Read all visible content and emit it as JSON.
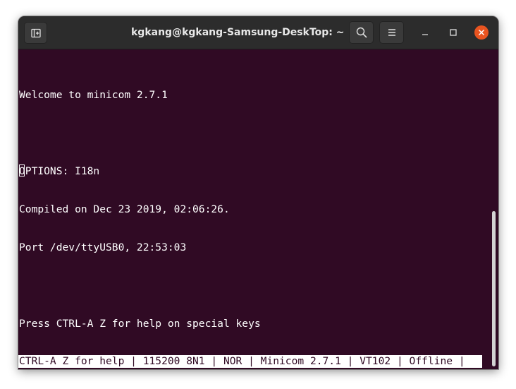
{
  "window": {
    "title": "kgkang@kgkang-Samsung-DeskTop: ~"
  },
  "titlebar": {
    "icons": {
      "new_tab": "new-tab-icon",
      "search": "search-icon",
      "menu": "hamburger-menu-icon",
      "minimize": "minimize-icon",
      "maximize": "maximize-icon",
      "close": "close-icon"
    }
  },
  "terminal": {
    "lines": [
      "Welcome to minicom 2.7.1",
      "",
      "OPTIONS: I18n",
      "Compiled on Dec 23 2019, 02:06:26.",
      "Port /dev/ttyUSB0, 22:53:03",
      "",
      "Press CTRL-A Z for help on special keys"
    ],
    "status_bar": "CTRL-A Z for help | 115200 8N1 | NOR | Minicom 2.7.1 | VT102 | Offline |"
  },
  "colors": {
    "terminal_background": "#300a24",
    "titlebar_background": "#2c2c2c",
    "close_button": "#e95420",
    "text": "#ffffff"
  }
}
